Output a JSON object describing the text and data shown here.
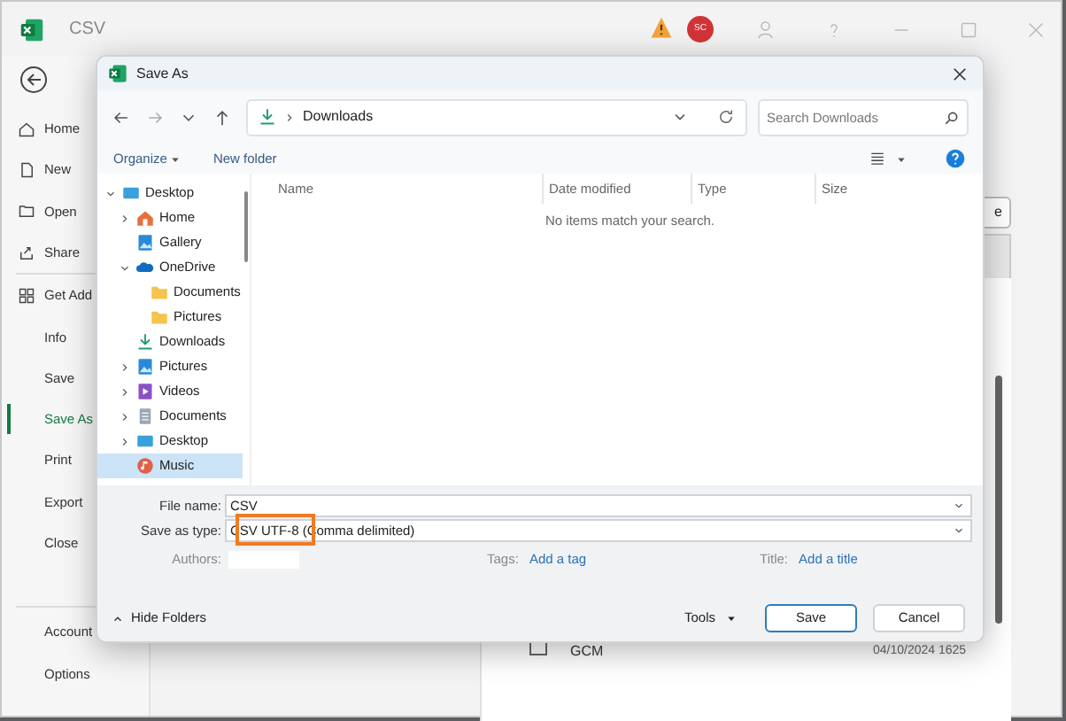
{
  "app_window": {
    "title": "CSV",
    "avatar": "SC"
  },
  "backstage_nav": [
    {
      "label": "Home",
      "kind": "home",
      "selected": false
    },
    {
      "label": "New",
      "kind": "new",
      "selected": false
    },
    {
      "label": "Open",
      "kind": "open",
      "selected": false
    },
    {
      "label": "Share",
      "kind": "share",
      "selected": false,
      "divider_after": true
    },
    {
      "label": "Get Add",
      "kind": "addins",
      "selected": false
    },
    {
      "label": "Info",
      "selected": false
    },
    {
      "label": "Save",
      "selected": false
    },
    {
      "label": "Save As",
      "selected": true
    },
    {
      "label": "Print",
      "selected": false
    },
    {
      "label": "Export",
      "selected": false
    },
    {
      "label": "Close",
      "selected": false
    }
  ],
  "backstage_nav_bottom": [
    {
      "label": "Account",
      "selected": false
    },
    {
      "label": "Options",
      "selected": false
    }
  ],
  "background_content": {
    "button_fragment": "e",
    "file_name": "GCM",
    "file_date": "04/10/2024 1625"
  },
  "dialog": {
    "title": "Save As",
    "address": {
      "location": "Downloads"
    },
    "search": {
      "placeholder": "Search Downloads"
    },
    "toolbar": {
      "organize": "Organize",
      "new_folder": "New folder"
    },
    "nav_tree": [
      {
        "label": "Desktop",
        "kind": "desktop",
        "expanded": true,
        "selected": false,
        "children": [
          {
            "label": "Home",
            "kind": "home",
            "expanded": false,
            "selected": false
          },
          {
            "label": "Gallery",
            "kind": "gallery",
            "selected": false
          },
          {
            "label": "OneDrive",
            "kind": "cloud",
            "expanded": true,
            "selected": false,
            "children": [
              {
                "label": "Documents",
                "kind": "folder",
                "selected": false
              },
              {
                "label": "Pictures",
                "kind": "folder",
                "selected": false
              }
            ]
          },
          {
            "label": "Downloads",
            "kind": "download",
            "selected": false
          },
          {
            "label": "Pictures",
            "kind": "gallery",
            "expanded": false,
            "selected": false
          },
          {
            "label": "Videos",
            "kind": "video",
            "expanded": false,
            "selected": false
          },
          {
            "label": "Documents",
            "kind": "doc",
            "expanded": false,
            "selected": false
          },
          {
            "label": "Desktop",
            "kind": "desktop",
            "expanded": false,
            "selected": false
          },
          {
            "label": "Music",
            "kind": "music",
            "selected": true
          }
        ]
      }
    ],
    "columns": [
      "Name",
      "Date modified",
      "Type",
      "Size"
    ],
    "empty_message": "No items match your search.",
    "file_name": {
      "label": "File name:",
      "value": "CSV"
    },
    "save_as_type": {
      "label": "Save as type:",
      "value": "CSV UTF-8 (Comma delimited)"
    },
    "authors": {
      "label": "Authors:"
    },
    "tags": {
      "label": "Tags:",
      "link": "Add a tag"
    },
    "doc_title": {
      "label": "Title:",
      "link": "Add a title"
    },
    "hide_folders": "Hide Folders",
    "tools": "Tools",
    "buttons": [
      {
        "label": "Save",
        "kind": "primary"
      },
      {
        "label": "Cancel",
        "kind": "secondary"
      }
    ]
  }
}
